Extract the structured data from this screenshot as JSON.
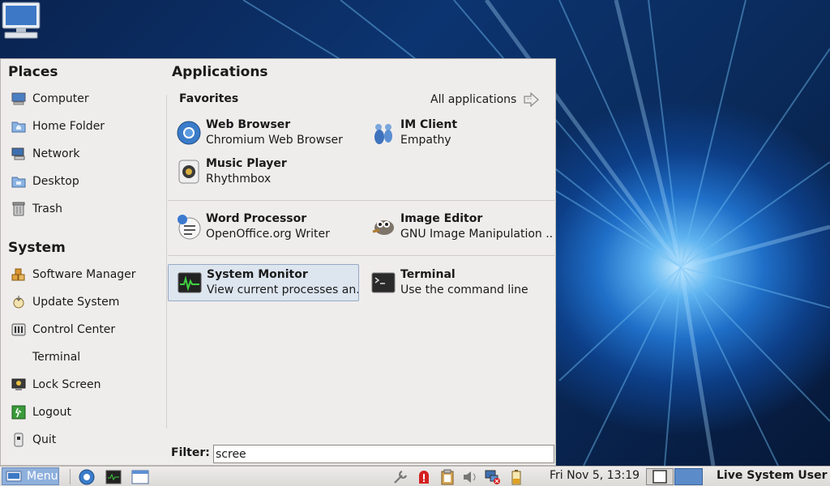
{
  "places": {
    "title": "Places",
    "items": [
      {
        "label": "Computer",
        "icon": "computer-icon"
      },
      {
        "label": "Home Folder",
        "icon": "home-folder-icon"
      },
      {
        "label": "Network",
        "icon": "network-icon"
      },
      {
        "label": "Desktop",
        "icon": "desktop-folder-icon"
      },
      {
        "label": "Trash",
        "icon": "trash-icon"
      }
    ]
  },
  "system": {
    "title": "System",
    "items": [
      {
        "label": "Software Manager",
        "icon": "package-icon"
      },
      {
        "label": "Update System",
        "icon": "update-icon"
      },
      {
        "label": "Control Center",
        "icon": "control-center-icon"
      },
      {
        "label": "Terminal",
        "icon": ""
      },
      {
        "label": "Lock Screen",
        "icon": "lock-screen-icon"
      },
      {
        "label": "Logout",
        "icon": "logout-icon"
      },
      {
        "label": "Quit",
        "icon": "quit-icon"
      }
    ]
  },
  "applications": {
    "title": "Applications",
    "favorites_title": "Favorites",
    "all_apps_label": "All applications",
    "apps": [
      {
        "name": "Web Browser",
        "desc": "Chromium Web Browser",
        "icon": "chromium-icon"
      },
      {
        "name": "IM Client",
        "desc": "Empathy",
        "icon": "empathy-icon"
      },
      {
        "name": "Music Player",
        "desc": "Rhythmbox",
        "icon": "rhythmbox-icon"
      },
      {
        "name": "Word Processor",
        "desc": "OpenOffice.org Writer",
        "icon": "writer-icon"
      },
      {
        "name": "Image Editor",
        "desc": "GNU Image Manipulation ...",
        "icon": "gimp-icon"
      },
      {
        "name": "System Monitor",
        "desc": "View current processes an...",
        "icon": "system-monitor-icon",
        "selected": true
      },
      {
        "name": "Terminal",
        "desc": "Use the command line",
        "icon": "terminal-icon"
      }
    ]
  },
  "filter": {
    "label": "Filter:",
    "value": "scree"
  },
  "taskbar": {
    "menu_label": "Menu",
    "clock": "Fri Nov  5, 13:19",
    "user": "Live System User"
  }
}
